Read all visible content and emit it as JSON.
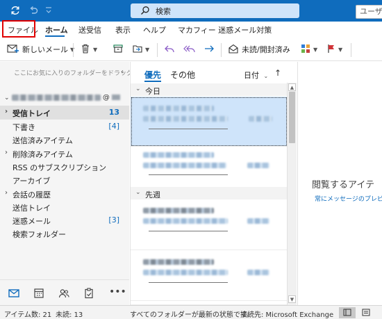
{
  "titlebar": {
    "search_placeholder": "検索",
    "icons": [
      "sync-icon",
      "undo-icon",
      "customize-toolbar-icon"
    ]
  },
  "tabs": [
    {
      "label": "ファイル"
    },
    {
      "label": "ホーム"
    },
    {
      "label": "送受信"
    },
    {
      "label": "表示"
    },
    {
      "label": "ヘルプ"
    },
    {
      "label": "マカフィー 迷惑メール対策"
    }
  ],
  "active_tab": "ホーム",
  "highlighted_tab": "ファイル",
  "ribbon": {
    "new_mail": "新しいメール",
    "unread_read": "未読/開封済み",
    "user_placeholder": "ユーザ"
  },
  "folderpane": {
    "favorites_hint": "ここにお気に入りのフォルダーをドラッグします",
    "account_suffix": "@",
    "folders": [
      {
        "name": "受信トレイ",
        "count": "13",
        "chevron": "›",
        "selected": true
      },
      {
        "name": "下書き",
        "count": "[4]"
      },
      {
        "name": "送信済みアイテム"
      },
      {
        "name": "削除済みアイテム",
        "chevron": "›"
      },
      {
        "name": "RSS のサブスクリプション"
      },
      {
        "name": "アーカイブ"
      },
      {
        "name": "会話の履歴",
        "chevron": "›"
      },
      {
        "name": "送信トレイ"
      },
      {
        "name": "迷惑メール",
        "count": "[3]"
      },
      {
        "name": "検索フォルダー"
      }
    ]
  },
  "msglist": {
    "tab_focused": "優先",
    "tab_other": "その他",
    "sort_label": "日付",
    "group_today": "今日",
    "group_lastweek": "先週"
  },
  "reading": {
    "title": "閲覧するアイテ",
    "link": "常にメッセージのプレビュー"
  },
  "statusbar": {
    "items": "アイテム数: 21",
    "unread": "未読: 13",
    "folders_status": "すべてのフォルダーが最新の状態です。",
    "connection": "接続先: Microsoft Exchange"
  },
  "colors": {
    "accent": "#0f6cbd",
    "selection": "#cfe4fa",
    "highlight_box": "#e00000"
  }
}
